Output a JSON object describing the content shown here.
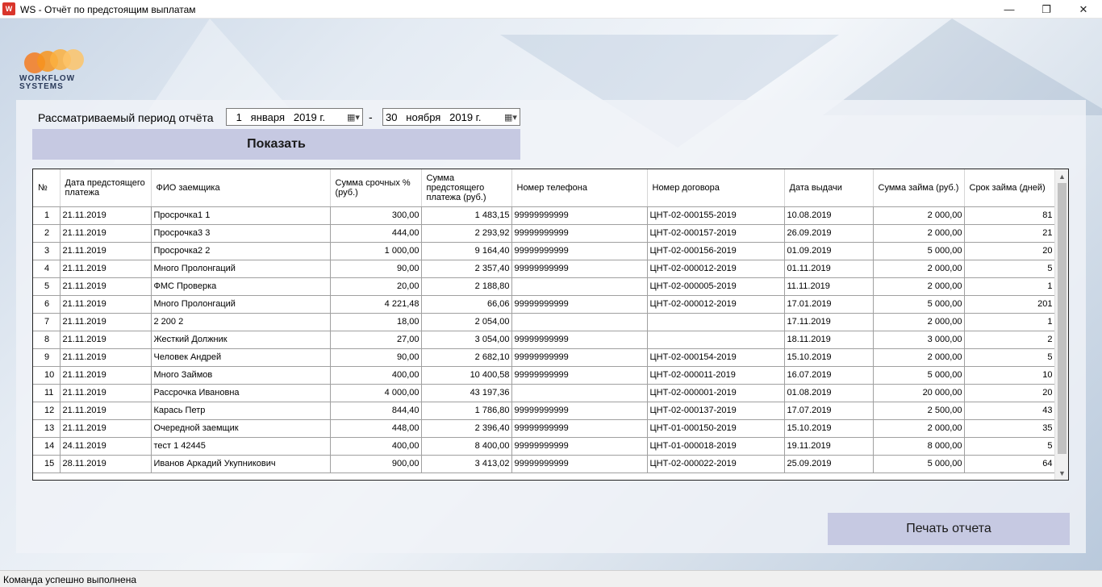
{
  "window": {
    "icon_text": "W",
    "title": "WS - Отчёт по предстоящим выплатам",
    "minimize_glyph": "—",
    "maximize_glyph": "❐",
    "close_glyph": "✕"
  },
  "logo": {
    "line1": "WORKFLOW",
    "line2": "SYSTEMS"
  },
  "period": {
    "label": "Рассматриваемый период отчёта",
    "from_date": " 1   января   2019 г.",
    "separator": "-",
    "to_date": "30   ноября   2019 г."
  },
  "show_button": "Показать",
  "table": {
    "columns": [
      "№",
      "Дата предстоящего платежа",
      "ФИО заемщика",
      "Сумма срочных % (руб.)",
      "Сумма предстоящего платежа (руб.)",
      "Номер телефона",
      "Номер договора",
      "Дата выдачи",
      "Сумма займа (руб.)",
      "Срок займа (дней)"
    ],
    "rows": [
      [
        "1",
        "21.11.2019",
        "Просрочка1 1",
        "300,00",
        "1 483,15",
        "99999999999",
        "ЦНТ-02-000155-2019",
        "10.08.2019",
        "2 000,00",
        "81"
      ],
      [
        "2",
        "21.11.2019",
        "Просрочка3 3",
        "444,00",
        "2 293,92",
        "99999999999",
        "ЦНТ-02-000157-2019",
        "26.09.2019",
        "2 000,00",
        "21"
      ],
      [
        "3",
        "21.11.2019",
        "Просрочка2 2",
        "1 000,00",
        "9 164,40",
        "99999999999",
        "ЦНТ-02-000156-2019",
        "01.09.2019",
        "5 000,00",
        "20"
      ],
      [
        "4",
        "21.11.2019",
        "Много Пролонгаций",
        "90,00",
        "2 357,40",
        "99999999999",
        "ЦНТ-02-000012-2019",
        "01.11.2019",
        "2 000,00",
        "5"
      ],
      [
        "5",
        "21.11.2019",
        "ФМС Проверка",
        "20,00",
        "2 188,80",
        "",
        "ЦНТ-02-000005-2019",
        "11.11.2019",
        "2 000,00",
        "1"
      ],
      [
        "6",
        "21.11.2019",
        "Много Пролонгаций",
        "4 221,48",
        "66,06",
        "99999999999",
        "ЦНТ-02-000012-2019",
        "17.01.2019",
        "5 000,00",
        "201"
      ],
      [
        "7",
        "21.11.2019",
        "2 200 2",
        "18,00",
        "2 054,00",
        "",
        "",
        "17.11.2019",
        "2 000,00",
        "1"
      ],
      [
        "8",
        "21.11.2019",
        "Жесткий Должник",
        "27,00",
        "3 054,00",
        "99999999999",
        "",
        "18.11.2019",
        "3 000,00",
        "2"
      ],
      [
        "9",
        "21.11.2019",
        "Человек Андрей",
        "90,00",
        "2 682,10",
        "99999999999",
        "ЦНТ-02-000154-2019",
        "15.10.2019",
        "2 000,00",
        "5"
      ],
      [
        "10",
        "21.11.2019",
        "Много Займов",
        "400,00",
        "10 400,58",
        "99999999999",
        "ЦНТ-02-000011-2019",
        "16.07.2019",
        "5 000,00",
        "10"
      ],
      [
        "11",
        "21.11.2019",
        "Рассрочка Ивановна",
        "4 000,00",
        "43 197,36",
        "",
        "ЦНТ-02-000001-2019",
        "01.08.2019",
        "20 000,00",
        "20"
      ],
      [
        "12",
        "21.11.2019",
        "Карась Петр",
        "844,40",
        "1 786,80",
        "99999999999",
        "ЦНТ-02-000137-2019",
        "17.07.2019",
        "2 500,00",
        "43"
      ],
      [
        "13",
        "21.11.2019",
        "Очередной заемщик",
        "448,00",
        "2 396,40",
        "99999999999",
        "ЦНТ-01-000150-2019",
        "15.10.2019",
        "2 000,00",
        "35"
      ],
      [
        "14",
        "24.11.2019",
        "тест 1 42445",
        "400,00",
        "8 400,00",
        "99999999999",
        "ЦНТ-01-000018-2019",
        "19.11.2019",
        "8 000,00",
        "5"
      ],
      [
        "15",
        "28.11.2019",
        "Иванов Аркадий Укупникович",
        "900,00",
        "3 413,02",
        "99999999999",
        "ЦНТ-02-000022-2019",
        "25.09.2019",
        "5 000,00",
        "64"
      ]
    ]
  },
  "scrollbar": {
    "up_glyph": "▲",
    "down_glyph": "▼"
  },
  "print_button": "Печать отчета",
  "status": "Команда успешно выполнена"
}
